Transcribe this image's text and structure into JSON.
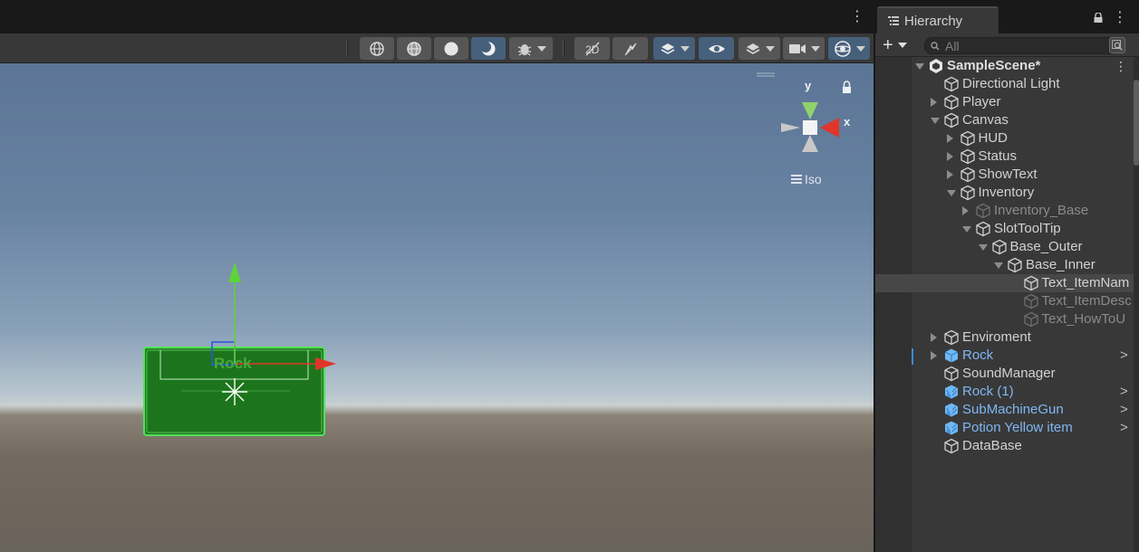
{
  "scene": {
    "toolbar_buttons": [
      {
        "id": "shading-wireframe",
        "icon": "wireframe-sphere-icon"
      },
      {
        "id": "shading-shaded-wireframe",
        "icon": "shaded-wireframe-sphere-icon"
      },
      {
        "id": "shading-shaded",
        "icon": "solid-sphere-icon"
      },
      {
        "id": "shading-unlit",
        "icon": "moon-icon",
        "active": true
      },
      {
        "id": "debug-draw-mode",
        "icon": "bug-icon"
      },
      {
        "id": "toggle-2d",
        "icon": "2d-icon"
      },
      {
        "id": "toggle-lighting",
        "icon": "lighting-icon"
      },
      {
        "id": "scene-visibility-layers",
        "icon": "layers-icon"
      },
      {
        "id": "scene-visibility",
        "icon": "eye-icon"
      },
      {
        "id": "render-layers",
        "icon": "stacked-layers-icon"
      },
      {
        "id": "camera",
        "icon": "camera-icon"
      },
      {
        "id": "gizmos",
        "icon": "gizmo-icon"
      }
    ],
    "gizmo": {
      "y_label": "y",
      "x_label": "x",
      "projection_label": "Iso"
    },
    "selected_object_label": "Rock",
    "colors": {
      "x_axis": "#e0362a",
      "y_axis": "#5fd33a",
      "z_axis": "#2f56d9",
      "selection": "#55e05a",
      "toolbar_active": "#46607c"
    }
  },
  "hierarchy": {
    "tab_title": "Hierarchy",
    "add_label": "+",
    "search_placeholder": "All",
    "rows": [
      {
        "label": "SampleScene*",
        "depth": 0,
        "arrow": "down",
        "kind": "scene",
        "menu": "⋮"
      },
      {
        "label": "Directional Light",
        "depth": 1,
        "arrow": "none",
        "kind": "gameobject"
      },
      {
        "label": "Player",
        "depth": 1,
        "arrow": "right",
        "kind": "gameobject"
      },
      {
        "label": "Canvas",
        "depth": 1,
        "arrow": "down",
        "kind": "gameobject"
      },
      {
        "label": "HUD",
        "depth": 2,
        "arrow": "right",
        "kind": "gameobject"
      },
      {
        "label": "Status",
        "depth": 2,
        "arrow": "right",
        "kind": "gameobject"
      },
      {
        "label": "ShowText",
        "depth": 2,
        "arrow": "right",
        "kind": "gameobject"
      },
      {
        "label": "Inventory",
        "depth": 2,
        "arrow": "down",
        "kind": "gameobject"
      },
      {
        "label": "Inventory_Base",
        "depth": 3,
        "arrow": "right",
        "kind": "gameobject",
        "dim": true
      },
      {
        "label": "SlotToolTip",
        "depth": 3,
        "arrow": "down",
        "kind": "gameobject"
      },
      {
        "label": "Base_Outer",
        "depth": 4,
        "arrow": "down",
        "kind": "gameobject"
      },
      {
        "label": "Base_Inner",
        "depth": 5,
        "arrow": "down",
        "kind": "gameobject"
      },
      {
        "label": "Text_ItemNam",
        "depth": 6,
        "arrow": "none",
        "kind": "gameobject",
        "selected": true
      },
      {
        "label": "Text_ItemDesc",
        "depth": 6,
        "arrow": "none",
        "kind": "gameobject",
        "dim": true
      },
      {
        "label": "Text_HowToU",
        "depth": 6,
        "arrow": "none",
        "kind": "gameobject",
        "dim": true
      },
      {
        "label": "Enviroment",
        "depth": 1,
        "arrow": "right",
        "kind": "gameobject"
      },
      {
        "label": "Rock",
        "depth": 1,
        "arrow": "right",
        "kind": "prefab",
        "chevron": ">"
      },
      {
        "label": "SoundManager",
        "depth": 1,
        "arrow": "none",
        "kind": "gameobject"
      },
      {
        "label": "Rock (1)",
        "depth": 1,
        "arrow": "none",
        "kind": "prefab-variant",
        "chevron": ">"
      },
      {
        "label": "SubMachineGun",
        "depth": 1,
        "arrow": "none",
        "kind": "prefab-variant",
        "chevron": ">"
      },
      {
        "label": "Potion Yellow item",
        "depth": 1,
        "arrow": "none",
        "kind": "prefab-variant",
        "chevron": ">"
      },
      {
        "label": "DataBase",
        "depth": 1,
        "arrow": "none",
        "kind": "gameobject"
      }
    ]
  }
}
